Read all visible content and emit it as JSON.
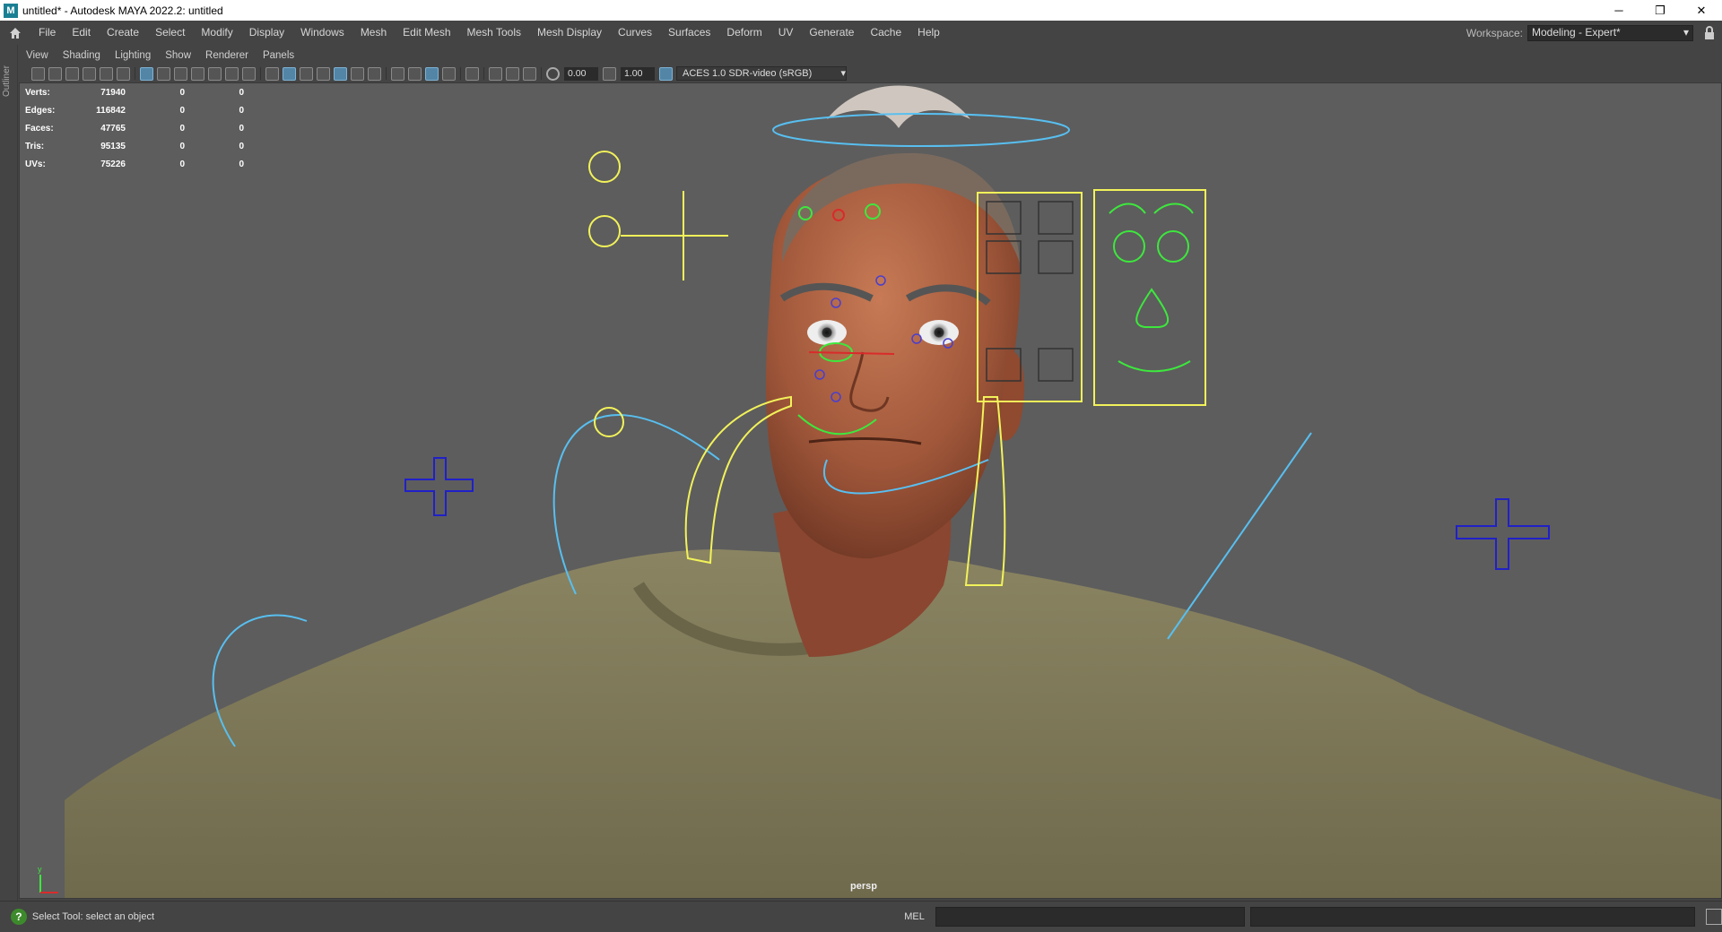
{
  "window": {
    "title": "untitled* - Autodesk MAYA 2022.2: untitled",
    "app_icon": "M",
    "controls": {
      "minimize": "─",
      "maximize": "❐",
      "close": "✕"
    }
  },
  "menubar": {
    "items": [
      "File",
      "Edit",
      "Create",
      "Select",
      "Modify",
      "Display",
      "Windows",
      "Mesh",
      "Edit Mesh",
      "Mesh Tools",
      "Mesh Display",
      "Curves",
      "Surfaces",
      "Deform",
      "UV",
      "Generate",
      "Cache",
      "Help"
    ],
    "workspace_label": "Workspace:",
    "workspace_value": "Modeling - Expert*"
  },
  "outliner_tab": "Outliner",
  "panel_menu": [
    "View",
    "Shading",
    "Lighting",
    "Show",
    "Renderer",
    "Panels"
  ],
  "toolbar": {
    "exposure": "0.00",
    "gamma": "1.00",
    "color_space": "ACES 1.0 SDR-video (sRGB)"
  },
  "hud": {
    "rows": [
      {
        "label": "Verts:",
        "v1": "71940",
        "v2": "0",
        "v3": "0"
      },
      {
        "label": "Edges:",
        "v1": "116842",
        "v2": "0",
        "v3": "0"
      },
      {
        "label": "Faces:",
        "v1": "47765",
        "v2": "0",
        "v3": "0"
      },
      {
        "label": "Tris:",
        "v1": "95135",
        "v2": "0",
        "v3": "0"
      },
      {
        "label": "UVs:",
        "v1": "75226",
        "v2": "0",
        "v3": "0"
      }
    ]
  },
  "viewport": {
    "camera": "persp",
    "background_color": "#5d5d5d",
    "skin_color": "#a0573a",
    "sweater_color": "#7e7858",
    "control_colors": {
      "yellow": "#f2f25a",
      "blue": "#58bff0",
      "green": "#3de83d",
      "red": "#d92b2b",
      "purple": "#4a3fcf"
    },
    "axis_labels": {
      "y": "y",
      "x": "x"
    }
  },
  "helpline": {
    "text": "Select Tool: select an object",
    "mel_label": "MEL"
  }
}
